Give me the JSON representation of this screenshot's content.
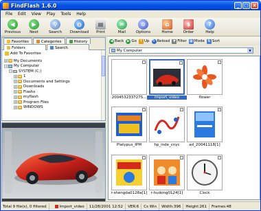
{
  "window": {
    "title": "FindFlash 1.6.0"
  },
  "menu": [
    "File",
    "Edit",
    "View",
    "Play",
    "Tools",
    "Help"
  ],
  "toolbar": {
    "previous": "Previous",
    "next": "Next",
    "search": "Search",
    "download": "Download",
    "print": "Print",
    "mail": "Mail",
    "options": "Options",
    "home": "Home",
    "order": "Order",
    "help": "Help"
  },
  "left_tabs": {
    "favorites": "Favorites",
    "categories": "Categories",
    "history": "History",
    "folders": "Folders",
    "search": "Search"
  },
  "add_favorites": "Add To Favorites",
  "tree": [
    "My Documents",
    "My Computer",
    "SYSTEM (C:)",
    "1",
    "Documents and Settings",
    "Downloads",
    "Flashs",
    "myflash",
    "Program Files",
    "WINDOWS"
  ],
  "right_toolbar": {
    "back": "Back",
    "go": "Go",
    "up": "Up",
    "reload": "Reload",
    "filter": "Filter",
    "mode": "Mode",
    "sort": "Sort"
  },
  "address": {
    "value": "My Computer"
  },
  "thumbnails": [
    {
      "caption": "200453233727S..."
    },
    {
      "caption": "Import_video",
      "selected": true
    },
    {
      "caption": "flower"
    },
    {
      "caption": "Platypus_IPM"
    },
    {
      "caption": "hp_inde_cnyc"
    },
    {
      "caption": "ad_20041118[1]"
    },
    {
      "caption": "r-shengda0128a[1]"
    },
    {
      "caption": "r-hudong0124[1]"
    },
    {
      "caption": "Clock"
    }
  ],
  "status": {
    "total": "Total 9 file(s), 0 filtered",
    "name": "Import_video",
    "date": "11/28/2001  12:52",
    "version": "VER:6",
    "cs": "Cs Win",
    "width": "Width:396",
    "height": "Height:261",
    "frames": "Frames:48"
  }
}
